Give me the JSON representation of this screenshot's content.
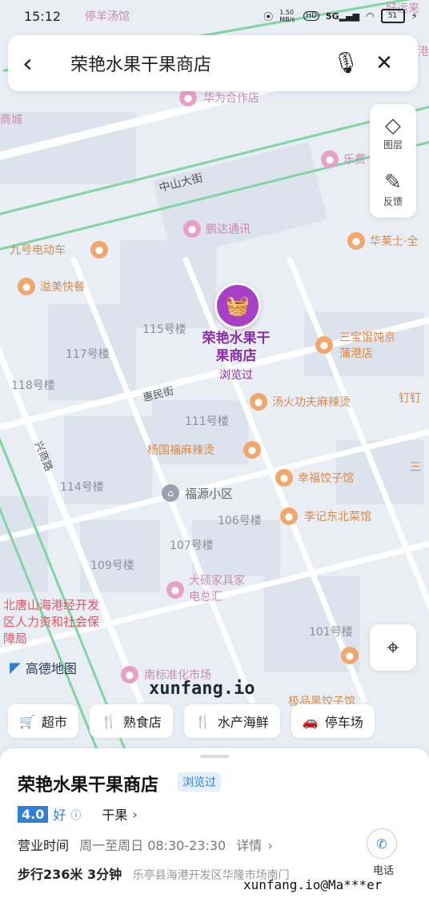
{
  "status_bar": {
    "time": "15:12",
    "net_speed": "1.50 MB/s",
    "hd": "HD",
    "signal": "5G",
    "battery": "51"
  },
  "search": {
    "query": "荣艳水果干果商店"
  },
  "tools": [
    {
      "label": "图层",
      "icon": "layers-icon"
    },
    {
      "label": "反馈",
      "icon": "edit-icon"
    }
  ],
  "map": {
    "road_labels": [
      "中山大街",
      "惠民街",
      "兴商路"
    ],
    "labels_gray": [
      "115号楼",
      "117号楼",
      "118号楼",
      "111号楼",
      "114号楼",
      "106号楼",
      "107号楼",
      "109号楼",
      "101号楼",
      "福源小区"
    ],
    "labels_orange": [
      "九号电动车",
      "溢美快餐",
      "华莱士·全",
      "三宝馄饨京蒲港店",
      "汤火功夫麻辣烫",
      "杨国福麻辣烫",
      "幸福饺子馆",
      "李记东北菜馆",
      "钉钉",
      "三",
      "极品黑饺子馆"
    ],
    "labels_pink": [
      "华为合作店",
      "鹏达通讯",
      "乐费",
      "大硕家具家电总汇",
      "南标准化市场",
      "停羊汤馆",
      "商城",
      "好运来",
      "港"
    ],
    "labels_red": [
      "北唐山海港经开发区人力资和社会保障局"
    ],
    "marker": {
      "name": "荣艳水果干果商店",
      "visited": "浏览过"
    },
    "logo": "高德地图",
    "watermark": "xunfang.io"
  },
  "categories": [
    "超市",
    "熟食店",
    "水产海鲜",
    "停车场"
  ],
  "place": {
    "name": "荣艳水果干果商店",
    "tag": "浏览过",
    "score": "4.0",
    "grade": "好",
    "category": "干果",
    "hours_label": "营业时间",
    "hours_value": "周一至周日 08:30-23:30",
    "details": "详情",
    "walk": "步行236米 3分钟",
    "address": "乐亭县海港开发区华隆市场南门",
    "phone_label": "电话"
  },
  "copyright": "xunfang.io@Ma***er"
}
